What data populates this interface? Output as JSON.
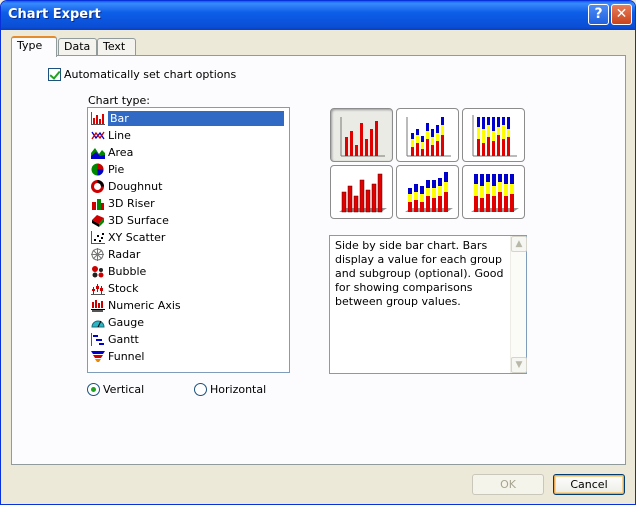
{
  "window": {
    "title": "Chart Expert"
  },
  "titlebar": {
    "help": "?",
    "close": "✕"
  },
  "tabs": [
    {
      "label": "Type",
      "active": true
    },
    {
      "label": "Data"
    },
    {
      "label": "Text"
    }
  ],
  "options": {
    "auto_set_label": "Automatically set chart options",
    "auto_set_checked": true
  },
  "chart_type": {
    "label": "Chart type:",
    "selected": "Bar",
    "items": [
      {
        "label": "Bar",
        "icon": "bar-chart-icon"
      },
      {
        "label": "Line",
        "icon": "line-chart-icon"
      },
      {
        "label": "Area",
        "icon": "area-chart-icon"
      },
      {
        "label": "Pie",
        "icon": "pie-chart-icon"
      },
      {
        "label": "Doughnut",
        "icon": "doughnut-chart-icon"
      },
      {
        "label": "3D Riser",
        "icon": "3d-riser-icon"
      },
      {
        "label": "3D Surface",
        "icon": "3d-surface-icon"
      },
      {
        "label": "XY Scatter",
        "icon": "xy-scatter-icon"
      },
      {
        "label": "Radar",
        "icon": "radar-chart-icon"
      },
      {
        "label": "Bubble",
        "icon": "bubble-chart-icon"
      },
      {
        "label": "Stock",
        "icon": "stock-chart-icon"
      },
      {
        "label": "Numeric Axis",
        "icon": "numeric-axis-icon"
      },
      {
        "label": "Gauge",
        "icon": "gauge-chart-icon"
      },
      {
        "label": "Gantt",
        "icon": "gantt-chart-icon"
      },
      {
        "label": "Funnel",
        "icon": "funnel-chart-icon"
      }
    ]
  },
  "orientation": {
    "vertical": "Vertical",
    "horizontal": "Horizontal",
    "selected": "vertical"
  },
  "subtypes": [
    {
      "name": "side-by-side-bar",
      "selected": true
    },
    {
      "name": "stacked-bar"
    },
    {
      "name": "percent-bar"
    },
    {
      "name": "3d-side-by-side-bar"
    },
    {
      "name": "3d-stacked-bar"
    },
    {
      "name": "3d-percent-bar"
    }
  ],
  "description": "Side by side bar chart. Bars display a value for each group and subgroup (optional). Good for showing comparisons between group values.",
  "buttons": {
    "ok": "OK",
    "cancel": "Cancel"
  },
  "colors": {
    "red": "#e00000",
    "yellow": "#ffff00",
    "blue": "#0000cc",
    "selection": "#316ac5"
  }
}
